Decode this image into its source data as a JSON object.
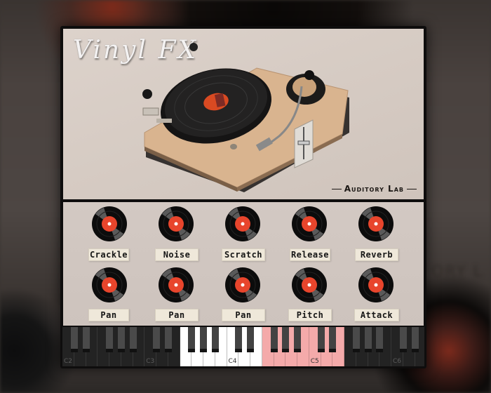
{
  "app": {
    "title": "Vinyl FX",
    "brand": "Auditory Lab"
  },
  "colors": {
    "record_label": "#e8452c",
    "panel": "#d3c9c3",
    "label_tape": "#efe8da",
    "key_range_active": "#ffffff",
    "key_range_alt": "#f4aaaa"
  },
  "knobs": {
    "row1": [
      {
        "label": "Crackle",
        "icon": "vinyl-record-knob"
      },
      {
        "label": "Noise",
        "icon": "vinyl-record-knob"
      },
      {
        "label": "Scratch",
        "icon": "vinyl-record-knob"
      },
      {
        "label": "Release",
        "icon": "vinyl-record-knob"
      },
      {
        "label": "Reverb",
        "icon": "vinyl-record-knob"
      }
    ],
    "row2": [
      {
        "label": "Pan",
        "icon": "vinyl-record-knob"
      },
      {
        "label": "Pan",
        "icon": "vinyl-record-knob"
      },
      {
        "label": "Pan",
        "icon": "vinyl-record-knob"
      },
      {
        "label": "Pitch",
        "icon": "vinyl-record-knob"
      },
      {
        "label": "Attack",
        "icon": "vinyl-record-knob"
      }
    ]
  },
  "keyboard": {
    "octave_labels": [
      "C2",
      "C3",
      "C4",
      "C5",
      "C6"
    ],
    "start_note": "C2",
    "white_range": [
      "F3",
      "E4"
    ],
    "pink_range": [
      "F4",
      "E5"
    ]
  }
}
